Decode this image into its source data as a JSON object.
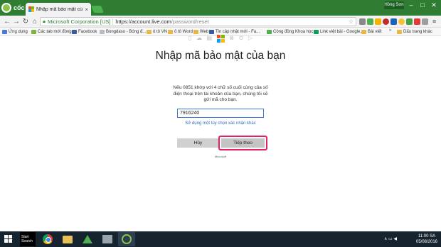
{
  "browser": {
    "brand": "cốc cốc",
    "tab_title": "Nhập mã bảo mật của bạn",
    "tab_close": "×",
    "user_badge": "Hồng Sơn",
    "window_controls": {
      "minimize": "–",
      "maximize": "□",
      "close": "✕"
    },
    "nav": {
      "back": "←",
      "forward": "→",
      "reload": "↻",
      "home": "⌂"
    },
    "address": {
      "ev_badge": "Microsoft Corporation [US]",
      "url_host": "https://account.live.com",
      "url_path": "/password/reset",
      "star": "☆"
    },
    "menu": "≡"
  },
  "bookmarks": [
    {
      "label": "Ứng dụng",
      "icon": "apps-grid-icon",
      "color": "#4a7bd0"
    },
    {
      "label": "Các tab mới đóng",
      "icon": "coccoc-icon",
      "color": "#7cb342"
    },
    {
      "label": "Facebook",
      "icon": "facebook-icon",
      "color": "#3b5998"
    },
    {
      "label": "Bongdaso - Bóng đ...",
      "icon": "page-icon",
      "color": "#bbbbbb"
    },
    {
      "label": "ô tô VN",
      "icon": "folder-icon",
      "color": "#e6b84a"
    },
    {
      "label": "ô tô Word",
      "icon": "folder-icon",
      "color": "#e6b84a"
    },
    {
      "label": "Web",
      "icon": "folder-icon",
      "color": "#e6b84a"
    },
    {
      "label": "Tin cập nhật mới - Fa...",
      "icon": "facebook-icon",
      "color": "#3b5998"
    },
    {
      "label": "Công đồng Khoa học",
      "icon": "page-icon",
      "color": "#4caf50"
    },
    {
      "label": "Link việt bài - Google...",
      "icon": "sheets-icon",
      "color": "#0f9d58"
    },
    {
      "label": "Bài viết",
      "icon": "folder-icon",
      "color": "#e6b84a"
    }
  ],
  "bookmarks_more": "»",
  "bookmarks_other": "Dấu trang khác",
  "page": {
    "product_icons": [
      "office-icon",
      "onedrive-icon",
      "outlook-icon",
      "microsoft-logo",
      "xbox-icon",
      "skype-icon",
      "bing-icon"
    ],
    "title": "Nhập mã bảo mật của bạn",
    "description": "Nếu 0851 khớp với 4 chữ số cuối cùng của số điện thoại trên tài khoản của bạn, chúng tôi sẽ gửi mã cho bạn.",
    "code_value": "7916240",
    "alt_link": "Sử dụng một tùy chọn xác nhận khác",
    "cancel_label": "Hủy",
    "next_label": "Tiếp theo",
    "footer": "Microsoft"
  },
  "taskbar": {
    "search_label": "Start",
    "search_sub": "Search",
    "tray": "∧ ▭ ◀",
    "time": "11:00 SA",
    "date": "05/08/2016"
  },
  "colors": {
    "browser_green": "#2e7d32",
    "highlight": "#e91e63",
    "link": "#2a6ebb",
    "ms_red": "#f25022",
    "ms_green": "#7fba00",
    "ms_blue": "#00a4ef",
    "ms_yellow": "#ffb900"
  }
}
